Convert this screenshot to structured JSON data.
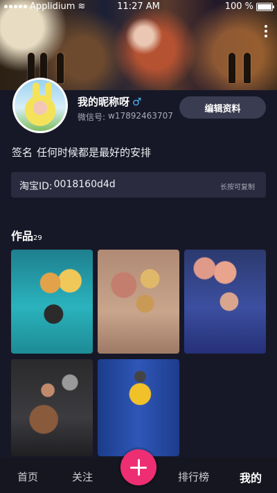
{
  "status_bar": {
    "carrier": "Applidium",
    "time": "11:27 AM",
    "battery": "100 %"
  },
  "profile": {
    "nickname": "我的昵称呀",
    "gender_symbol": "♂",
    "wechat_label": "微信号:",
    "wechat_id": "w17892463707",
    "edit_button": "编辑资料",
    "signature_label": "签名",
    "signature_text": "任何时候都是最好的安排",
    "taobao_label": "淘宝ID:",
    "taobao_id": "0018160d4d",
    "copy_hint": "长按可复制"
  },
  "works": {
    "title": "作品",
    "count": "29"
  },
  "tabbar": {
    "home": "首页",
    "follow": "关注",
    "ranking": "排行榜",
    "me": "我的"
  },
  "colors": {
    "background": "#171827",
    "accent": "#ee2e72",
    "gender": "#4fb3f2"
  }
}
